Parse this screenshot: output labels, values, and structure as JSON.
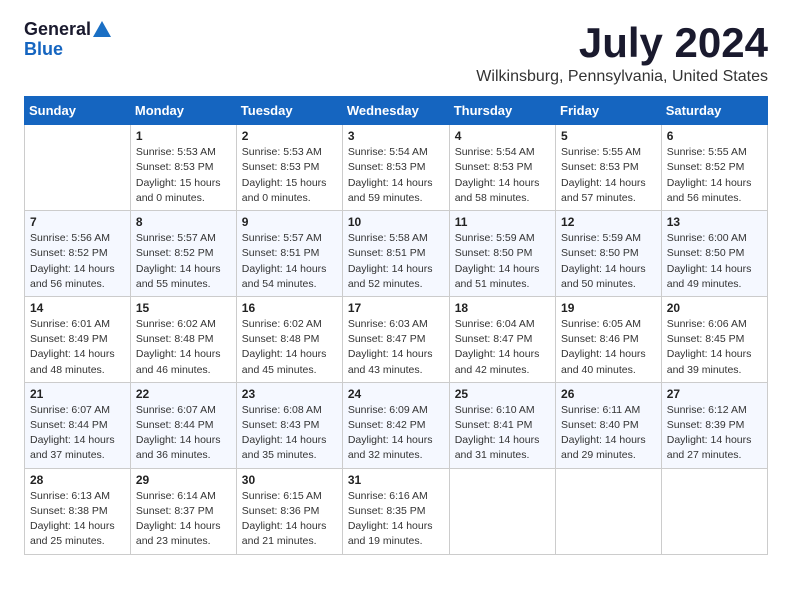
{
  "header": {
    "logo_general": "General",
    "logo_blue": "Blue",
    "month": "July 2024",
    "location": "Wilkinsburg, Pennsylvania, United States"
  },
  "weekdays": [
    "Sunday",
    "Monday",
    "Tuesday",
    "Wednesday",
    "Thursday",
    "Friday",
    "Saturday"
  ],
  "weeks": [
    [
      {
        "day": "",
        "info": ""
      },
      {
        "day": "1",
        "info": "Sunrise: 5:53 AM\nSunset: 8:53 PM\nDaylight: 15 hours\nand 0 minutes."
      },
      {
        "day": "2",
        "info": "Sunrise: 5:53 AM\nSunset: 8:53 PM\nDaylight: 15 hours\nand 0 minutes."
      },
      {
        "day": "3",
        "info": "Sunrise: 5:54 AM\nSunset: 8:53 PM\nDaylight: 14 hours\nand 59 minutes."
      },
      {
        "day": "4",
        "info": "Sunrise: 5:54 AM\nSunset: 8:53 PM\nDaylight: 14 hours\nand 58 minutes."
      },
      {
        "day": "5",
        "info": "Sunrise: 5:55 AM\nSunset: 8:53 PM\nDaylight: 14 hours\nand 57 minutes."
      },
      {
        "day": "6",
        "info": "Sunrise: 5:55 AM\nSunset: 8:52 PM\nDaylight: 14 hours\nand 56 minutes."
      }
    ],
    [
      {
        "day": "7",
        "info": ""
      },
      {
        "day": "8",
        "info": "Sunrise: 5:57 AM\nSunset: 8:52 PM\nDaylight: 14 hours\nand 55 minutes."
      },
      {
        "day": "9",
        "info": "Sunrise: 5:57 AM\nSunset: 8:51 PM\nDaylight: 14 hours\nand 54 minutes."
      },
      {
        "day": "10",
        "info": "Sunrise: 5:58 AM\nSunset: 8:51 PM\nDaylight: 14 hours\nand 52 minutes."
      },
      {
        "day": "11",
        "info": "Sunrise: 5:59 AM\nSunset: 8:50 PM\nDaylight: 14 hours\nand 51 minutes."
      },
      {
        "day": "12",
        "info": "Sunrise: 5:59 AM\nSunset: 8:50 PM\nDaylight: 14 hours\nand 50 minutes."
      },
      {
        "day": "13",
        "info": "Sunrise: 6:00 AM\nSunset: 8:50 PM\nDaylight: 14 hours\nand 49 minutes."
      }
    ],
    [
      {
        "day": "14",
        "info": ""
      },
      {
        "day": "15",
        "info": "Sunrise: 6:02 AM\nSunset: 8:48 PM\nDaylight: 14 hours\nand 46 minutes."
      },
      {
        "day": "16",
        "info": "Sunrise: 6:02 AM\nSunset: 8:48 PM\nDaylight: 14 hours\nand 45 minutes."
      },
      {
        "day": "17",
        "info": "Sunrise: 6:03 AM\nSunset: 8:47 PM\nDaylight: 14 hours\nand 43 minutes."
      },
      {
        "day": "18",
        "info": "Sunrise: 6:04 AM\nSunset: 8:47 PM\nDaylight: 14 hours\nand 42 minutes."
      },
      {
        "day": "19",
        "info": "Sunrise: 6:05 AM\nSunset: 8:46 PM\nDaylight: 14 hours\nand 40 minutes."
      },
      {
        "day": "20",
        "info": "Sunrise: 6:06 AM\nSunset: 8:45 PM\nDaylight: 14 hours\nand 39 minutes."
      }
    ],
    [
      {
        "day": "21",
        "info": ""
      },
      {
        "day": "22",
        "info": "Sunrise: 6:07 AM\nSunset: 8:44 PM\nDaylight: 14 hours\nand 36 minutes."
      },
      {
        "day": "23",
        "info": "Sunrise: 6:08 AM\nSunset: 8:43 PM\nDaylight: 14 hours\nand 35 minutes."
      },
      {
        "day": "24",
        "info": "Sunrise: 6:09 AM\nSunset: 8:42 PM\nDaylight: 14 hours\nand 32 minutes."
      },
      {
        "day": "25",
        "info": "Sunrise: 6:10 AM\nSunset: 8:41 PM\nDaylight: 14 hours\nand 31 minutes."
      },
      {
        "day": "26",
        "info": "Sunrise: 6:11 AM\nSunset: 8:40 PM\nDaylight: 14 hours\nand 29 minutes."
      },
      {
        "day": "27",
        "info": "Sunrise: 6:12 AM\nSunset: 8:39 PM\nDaylight: 14 hours\nand 27 minutes."
      }
    ],
    [
      {
        "day": "28",
        "info": "Sunrise: 6:13 AM\nSunset: 8:38 PM\nDaylight: 14 hours\nand 25 minutes."
      },
      {
        "day": "29",
        "info": "Sunrise: 6:14 AM\nSunset: 8:37 PM\nDaylight: 14 hours\nand 23 minutes."
      },
      {
        "day": "30",
        "info": "Sunrise: 6:15 AM\nSunset: 8:36 PM\nDaylight: 14 hours\nand 21 minutes."
      },
      {
        "day": "31",
        "info": "Sunrise: 6:16 AM\nSunset: 8:35 PM\nDaylight: 14 hours\nand 19 minutes."
      },
      {
        "day": "",
        "info": ""
      },
      {
        "day": "",
        "info": ""
      },
      {
        "day": "",
        "info": ""
      }
    ]
  ],
  "week1_sunday": "Sunrise: 5:56 AM\nSunset: 8:52 PM\nDaylight: 14 hours\nand 56 minutes.",
  "week2_sunday": "Sunrise: 6:01 AM\nSunset: 8:49 PM\nDaylight: 14 hours\nand 48 minutes.",
  "week3_sunday": "Sunrise: 6:07 AM\nSunset: 8:44 PM\nDaylight: 14 hours\nand 37 minutes."
}
